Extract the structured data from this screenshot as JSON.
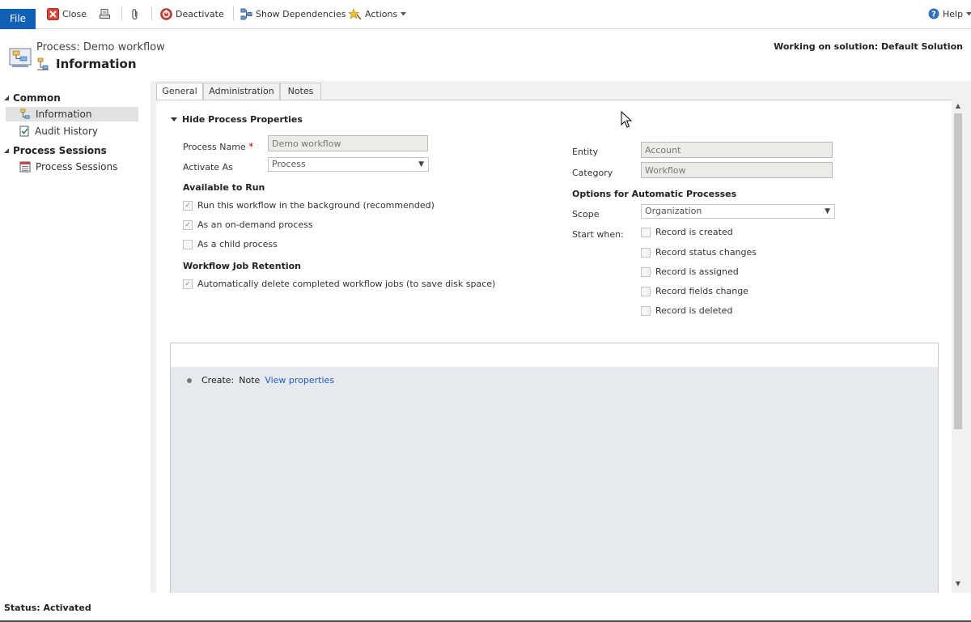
{
  "ribbon": {
    "file_label": "File",
    "close_label": "Close",
    "deactivate_label": "Deactivate",
    "show_dependencies_label": "Show Dependencies",
    "actions_label": "Actions",
    "help_label": "Help"
  },
  "header": {
    "process_line": "Process: Demo workflow",
    "title": "Information",
    "solution": "Working on solution: Default Solution"
  },
  "leftnav": {
    "groups": [
      {
        "label": "Common",
        "items": [
          {
            "label": "Information"
          },
          {
            "label": "Audit History"
          }
        ]
      },
      {
        "label": "Process Sessions",
        "items": [
          {
            "label": "Process Sessions"
          }
        ]
      }
    ]
  },
  "tabs": [
    {
      "label": "General"
    },
    {
      "label": "Administration"
    },
    {
      "label": "Notes"
    }
  ],
  "general": {
    "section_title": "Hide Process Properties",
    "process_name_label": "Process Name",
    "required_mark": "*",
    "process_name_value": "Demo workflow",
    "activate_as_label": "Activate As",
    "activate_as_value": "Process",
    "available_heading": "Available to Run",
    "run_background": "Run this workflow in the background (recommended)",
    "on_demand": "As an on-demand process",
    "child_process": "As a child process",
    "retention_heading": "Workflow Job Retention",
    "auto_delete": "Automatically delete completed workflow jobs (to save disk space)",
    "entity_label": "Entity",
    "entity_value": "Account",
    "category_label": "Category",
    "category_value": "Workflow",
    "options_heading": "Options for Automatic Processes",
    "scope_label": "Scope",
    "scope_value": "Organization",
    "start_when_label": "Start when:",
    "start_options": [
      {
        "label": "Record is created"
      },
      {
        "label": "Record status changes"
      },
      {
        "label": "Record is assigned"
      },
      {
        "label": "Record fields change"
      },
      {
        "label": "Record is deleted"
      }
    ],
    "checked_mark": "✓"
  },
  "designer": {
    "step_action": "Create:",
    "step_entity": "Note",
    "step_link": "View properties"
  },
  "status": {
    "text": "Status: Activated"
  }
}
